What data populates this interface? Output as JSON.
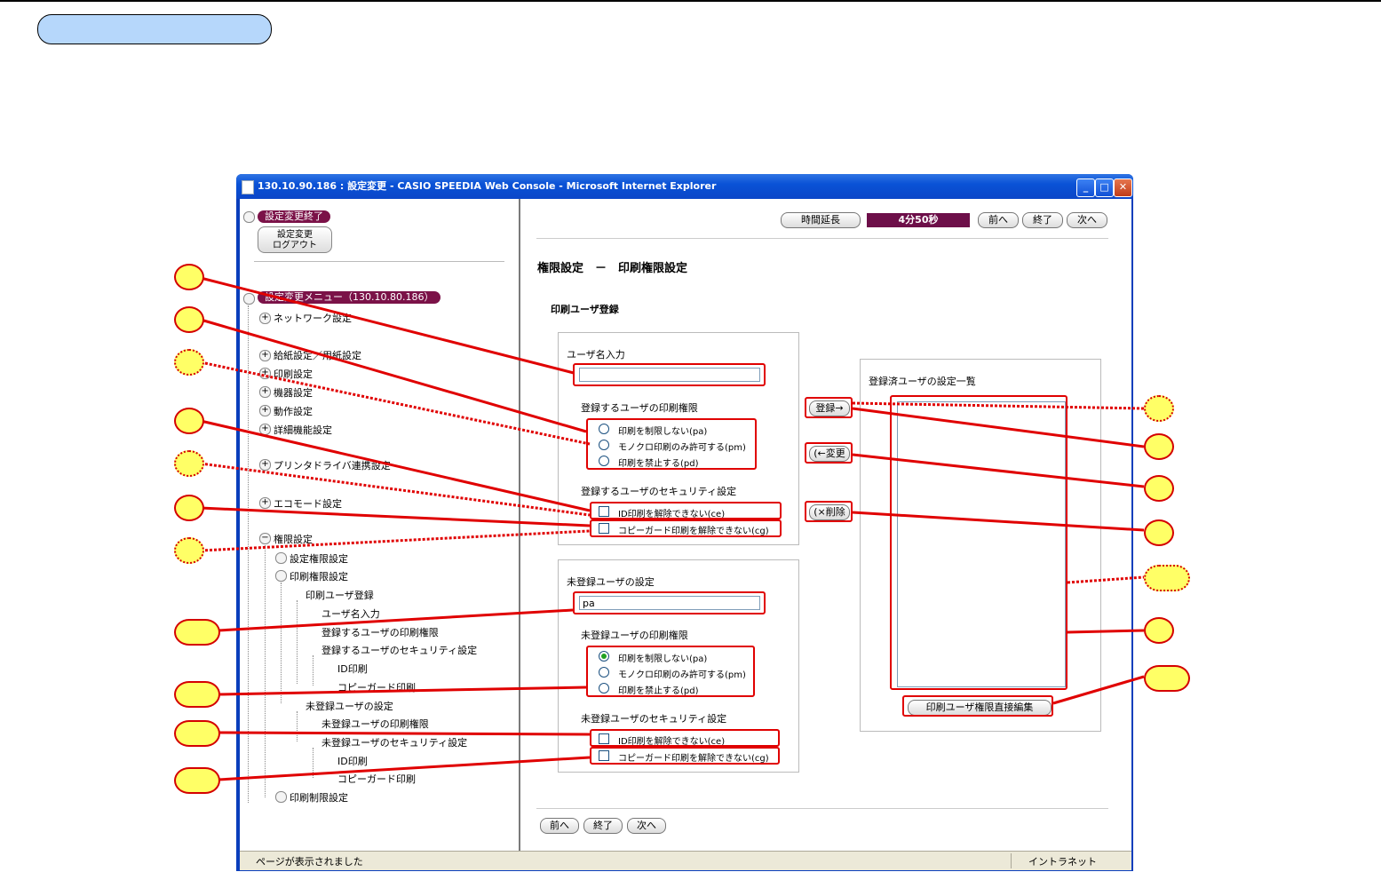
{
  "window": {
    "title": "130.10.90.186 : 設定変更 - CASIO SPEEDIA Web Console - Microsoft Internet Explorer",
    "min_glyph": "_",
    "max_glyph": "□",
    "close_glyph": "✕"
  },
  "statusbar": {
    "left_text": "ページが表示されました",
    "zone_text": "イントラネット"
  },
  "sidebar": {
    "end_badge": "設定変更終了",
    "logout_line1": "設定変更",
    "logout_line2": "ログアウト",
    "menu_badge": "設定変更メニュー（130.10.80.186）",
    "items": [
      {
        "label": "ネットワーク設定",
        "toggle": "+"
      },
      {
        "label": "給紙設定／用紙設定",
        "toggle": "+"
      },
      {
        "label": "印刷設定",
        "toggle": "+"
      },
      {
        "label": "機器設定",
        "toggle": "+"
      },
      {
        "label": "動作設定",
        "toggle": "+"
      },
      {
        "label": "詳細機能設定",
        "toggle": "+"
      },
      {
        "label": "プリンタドライバ連携設定",
        "toggle": "+"
      },
      {
        "label": "エコモード設定",
        "toggle": "+"
      },
      {
        "label": "権限設定",
        "toggle": "−"
      }
    ],
    "sub": {
      "perm_settings": "設定権限設定",
      "print_perm": "印刷権限設定",
      "print_user_reg": "印刷ユーザ登録",
      "user_name_input": "ユーザ名入力",
      "reg_user_print_perm": "登録するユーザの印刷権限",
      "reg_user_security": "登録するユーザのセキュリティ設定",
      "id_print": "ID印刷",
      "copy_guard": "コピーガード印刷",
      "unreg_settings": "未登録ユーザの設定",
      "unreg_print_perm": "未登録ユーザの印刷権限",
      "unreg_security": "未登録ユーザのセキュリティ設定",
      "id_print2": "ID印刷",
      "copy_guard2": "コピーガード印刷",
      "print_limit": "印刷制限設定"
    }
  },
  "topbar": {
    "extend": "時間延長",
    "timer": "4分50秒",
    "prev": "前へ",
    "end": "終了",
    "next": "次へ"
  },
  "main": {
    "page_title": "権限設定　－　印刷権限設定",
    "section": "印刷ユーザ登録",
    "reg": {
      "name_label": "ユーザ名入力",
      "name_value": "",
      "perm_label": "登録するユーザの印刷権限",
      "perm_options": [
        "印刷を制限しない(pa)",
        "モノクロ印刷のみ許可する(pm)",
        "印刷を禁止する(pd)"
      ],
      "security_label": "登録するユーザのセキュリティ設定",
      "chk_id": "ID印刷を解除できない(ce)",
      "chk_copy": "コピーガード印刷を解除できない(cg)"
    },
    "unreg": {
      "title": "未登録ユーザの設定",
      "value": "pa",
      "perm_label": "未登録ユーザの印刷権限",
      "perm_options": [
        "印刷を制限しない(pa)",
        "モノクロ印刷のみ許可する(pm)",
        "印刷を禁止する(pd)"
      ],
      "security_label": "未登録ユーザのセキュリティ設定",
      "chk_id": "ID印刷を解除できない(ce)",
      "chk_copy": "コピーガード印刷を解除できない(cg)"
    },
    "register_btn": "登録→",
    "change_btn": "(←変更",
    "delete_btn": "(×削除",
    "list_title": "登録済ユーザの設定一覧",
    "direct_edit_btn": "印刷ユーザ権限直接編集"
  },
  "bottom": {
    "prev": "前へ",
    "end": "終了",
    "next": "次へ"
  },
  "colors": {
    "annotation_red": "#e00000",
    "callout_fill": "#ffff66",
    "badge": "#7b1248",
    "timer_bg": "#6d0f49"
  }
}
